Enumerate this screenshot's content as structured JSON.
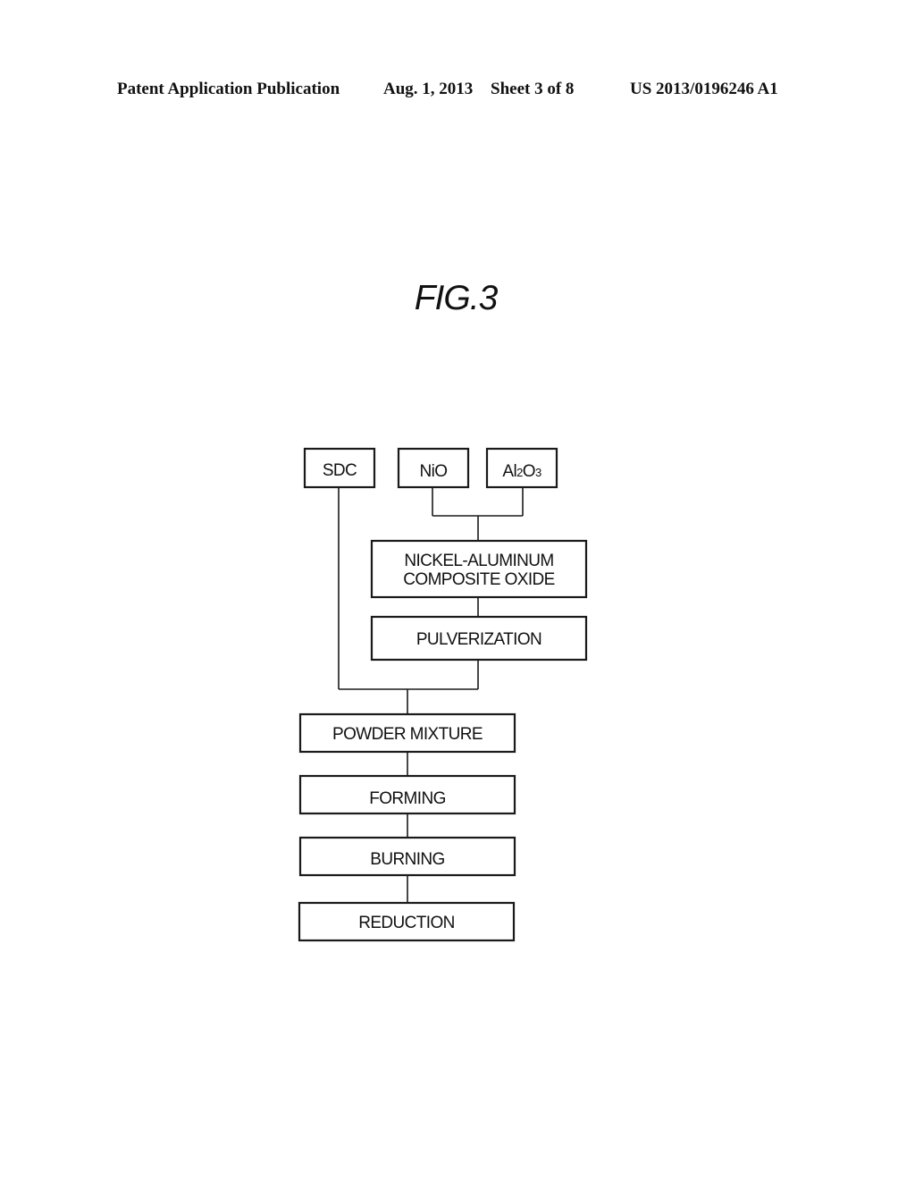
{
  "header": {
    "publication": "Patent Application Publication",
    "date": "Aug. 1, 2013",
    "sheet": "Sheet 3 of 8",
    "number": "US 2013/0196246 A1"
  },
  "figure": {
    "title": "FIG.3",
    "nodes": {
      "sdc": "SDC",
      "nio": "NiO",
      "al2o3": {
        "a": "Al",
        "sub1": "2",
        "b": "O",
        "sub2": "3"
      },
      "composite_line1": "NICKEL-ALUMINUM",
      "composite_line2": "COMPOSITE OXIDE",
      "pulverization": "PULVERIZATION",
      "powder_mixture": "POWDER MIXTURE",
      "forming": "FORMING",
      "burning": "BURNING",
      "reduction": "REDUCTION"
    }
  }
}
